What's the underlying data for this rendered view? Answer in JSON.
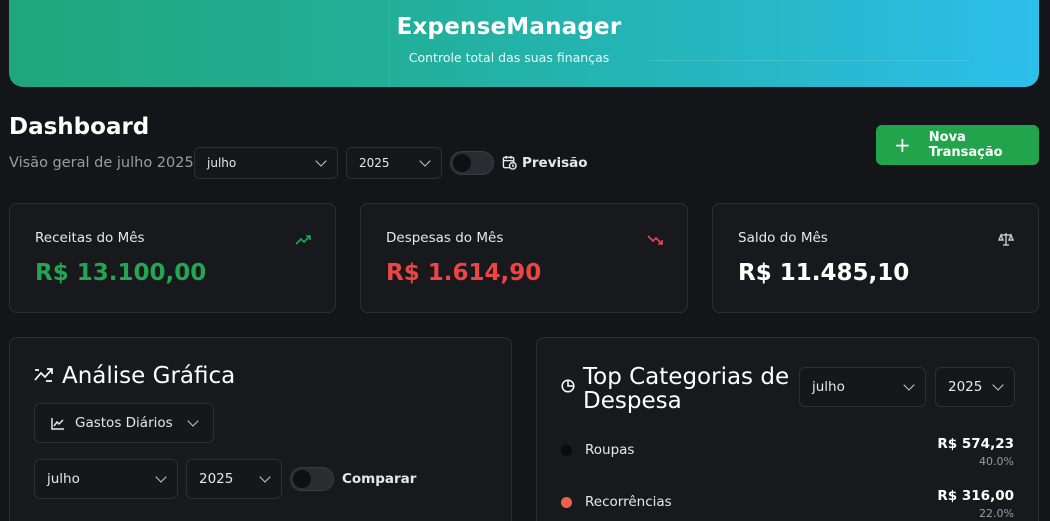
{
  "header": {
    "brand": "ExpenseManager",
    "tagline": "Controle total das suas finanças"
  },
  "dashboard": {
    "title": "Dashboard",
    "subtitle": "Visão geral de julho 2025",
    "month_select": "julho",
    "year_select": "2025",
    "forecast_label": "Previsão",
    "forecast_enabled": false,
    "new_transaction_label": "Nova Transação"
  },
  "stats": [
    {
      "label": "Receitas do Mês",
      "value": "R$ 13.100,00",
      "color": "#22a652",
      "icon": "trending-up-icon"
    },
    {
      "label": "Despesas do Mês",
      "value": "R$ 1.614,90",
      "color": "#ef4444",
      "icon": "trending-down-icon"
    },
    {
      "label": "Saldo do Mês",
      "value": "R$ 11.485,10",
      "color": "#ffffff",
      "icon": "scale-icon"
    }
  ],
  "analysis": {
    "title": "Análise Gráfica",
    "chart_type_select": "Gastos Diários",
    "month_select": "julho",
    "year_select": "2025",
    "compare_label": "Comparar",
    "compare_enabled": false
  },
  "top_categories": {
    "title_line1": "Top Categorias de",
    "title_line2": "Despesa",
    "month_select": "julho",
    "year_select": "2025",
    "items": [
      {
        "name": "Roupas",
        "amount": "R$ 574,23",
        "percent": "40.0%",
        "color": "#0b0b0d"
      },
      {
        "name": "Recorrências",
        "amount": "R$ 316,00",
        "percent": "22.0%",
        "color": "#f0614a"
      }
    ]
  },
  "colors": {
    "background": "#141518",
    "card": "#18191d",
    "accent_green": "#21a44b",
    "banner_start": "#1fa67a",
    "banner_end": "#2cbfeb"
  }
}
